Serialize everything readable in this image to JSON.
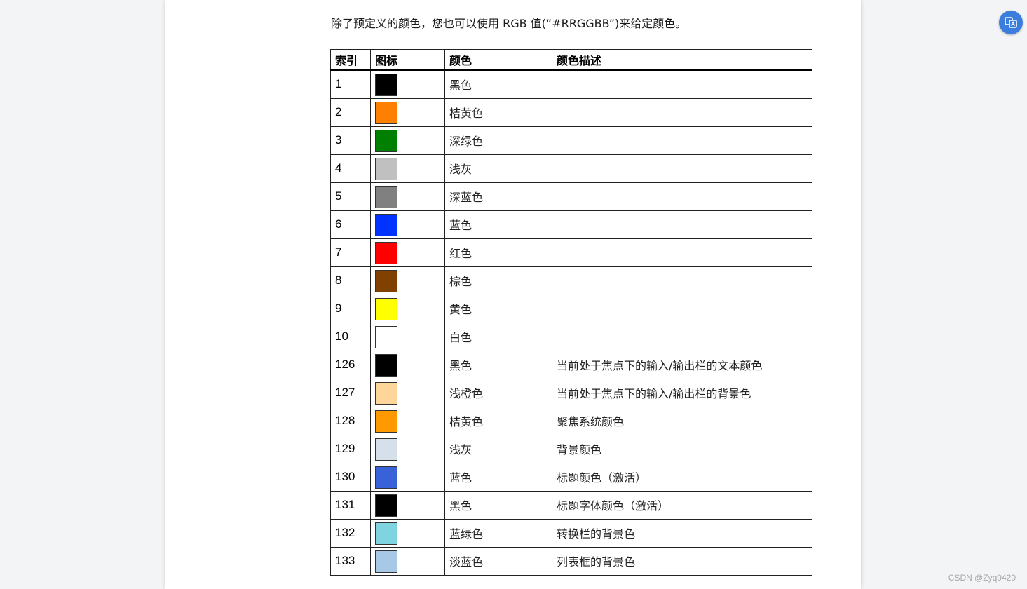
{
  "intro_text": "除了预定义的颜色，您也可以使用 RGB 值(“#RRGGBB”)来给定颜色。",
  "table": {
    "headers": [
      "索引",
      "图标",
      "颜色",
      "颜色描述"
    ],
    "rows": [
      {
        "index": "1",
        "swatch": "#000000",
        "color": "黑色",
        "desc": ""
      },
      {
        "index": "2",
        "swatch": "#ff8000",
        "color": "桔黄色",
        "desc": ""
      },
      {
        "index": "3",
        "swatch": "#008000",
        "color": "深绿色",
        "desc": ""
      },
      {
        "index": "4",
        "swatch": "#c0c0c0",
        "color": "浅灰",
        "desc": ""
      },
      {
        "index": "5",
        "swatch": "#808080",
        "color": "深蓝色",
        "desc": ""
      },
      {
        "index": "6",
        "swatch": "#0033ff",
        "color": "蓝色",
        "desc": ""
      },
      {
        "index": "7",
        "swatch": "#ff0000",
        "color": "红色",
        "desc": ""
      },
      {
        "index": "8",
        "swatch": "#804000",
        "color": "棕色",
        "desc": ""
      },
      {
        "index": "9",
        "swatch": "#ffff00",
        "color": "黄色",
        "desc": ""
      },
      {
        "index": "10",
        "swatch": "#ffffff",
        "color": "白色",
        "desc": ""
      },
      {
        "index": "126",
        "swatch": "#000000",
        "color": "黑色",
        "desc": "当前处于焦点下的输入/输出栏的文本颜色"
      },
      {
        "index": "127",
        "swatch": "#ffd699",
        "color": "浅橙色",
        "desc": "当前处于焦点下的输入/输出栏的背景色"
      },
      {
        "index": "128",
        "swatch": "#ff9900",
        "color": "桔黄色",
        "desc": "聚焦系统颜色"
      },
      {
        "index": "129",
        "swatch": "#d6e0eb",
        "color": "浅灰",
        "desc": "背景颜色"
      },
      {
        "index": "130",
        "swatch": "#3a62d8",
        "color": "蓝色",
        "desc": "标题颜色（激活）"
      },
      {
        "index": "131",
        "swatch": "#000000",
        "color": "黑色",
        "desc": "标题字体颜色（激活）"
      },
      {
        "index": "132",
        "swatch": "#80d4e0",
        "color": "蓝绿色",
        "desc": "转换栏的背景色"
      },
      {
        "index": "133",
        "swatch": "#a8c8e8",
        "color": "淡蓝色",
        "desc": "列表框的背景色"
      }
    ]
  },
  "fab_icon": "translate-icon",
  "watermark": "CSDN @Zyq0420"
}
